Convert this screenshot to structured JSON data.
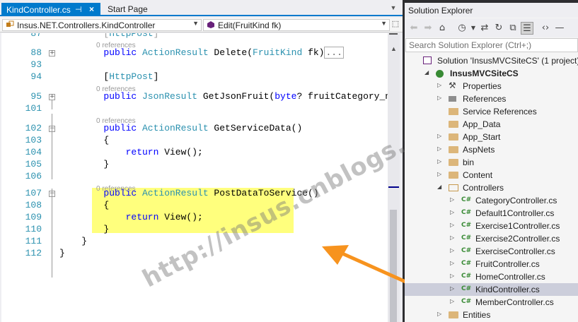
{
  "tabs": {
    "active_label": "KindController.cs",
    "pin_icon": "pin-icon",
    "close_glyph": "×",
    "start_label": "Start Page"
  },
  "navbar": {
    "class_value": "Insus.NET.Controllers.KindController",
    "member_value": "Edit(FruitKind fk)"
  },
  "code": {
    "lines": [
      {
        "num": "87",
        "text": "[HttpPost]"
      },
      {
        "ref": "0 references"
      },
      {
        "num": "88",
        "pre": "public ",
        "type": "ActionResult",
        "post": " Delete(",
        "type2": "FruitKind",
        "post2": " fk)",
        "collapsed": "..."
      },
      {
        "num": "93"
      },
      {
        "num": "94",
        "text": "[HttpPost]"
      },
      {
        "ref": "0 references"
      },
      {
        "num": "95",
        "pre": "public ",
        "type": "JsonResult",
        "post": " GetJsonFruit(",
        "kw2": "byte",
        "post2": "? fruitCategory_nbr)",
        "collapsed": "..."
      },
      {
        "num": "101"
      },
      {
        "ref": "0 references"
      },
      {
        "num": "102",
        "pre": "public ",
        "type": "ActionResult",
        "post": " GetServiceData()"
      },
      {
        "num": "103",
        "text": "{"
      },
      {
        "num": "104",
        "kwtext": "return",
        "text": " View();"
      },
      {
        "num": "105",
        "text": "}"
      },
      {
        "num": "106"
      },
      {
        "ref": "0 references"
      },
      {
        "num": "107",
        "pre": "public ",
        "type": "ActionResult",
        "post": " PostDataToService()"
      },
      {
        "num": "108",
        "text": "{"
      },
      {
        "num": "109",
        "kwtext": "return",
        "text": " View();"
      },
      {
        "num": "110",
        "text": "}"
      },
      {
        "num": "111",
        "text": "}"
      },
      {
        "num": "112",
        "text": "}"
      }
    ]
  },
  "watermark": "http://insus.cnblogs.com",
  "solution_explorer": {
    "title": "Solution Explorer",
    "search_placeholder": "Search Solution Explorer (Ctrl+;)",
    "toolbar_icons": [
      "back-icon",
      "forward-icon",
      "home-icon",
      "history-icon",
      "sync-icon",
      "refresh-icon",
      "collapse-all-icon",
      "show-all-files-icon",
      "view-code-icon",
      "properties-icon"
    ],
    "tree": [
      {
        "label": "Solution 'InsusMVCSiteCS' (1 project)",
        "icon": "solution-icon",
        "indent": 0,
        "exp": ""
      },
      {
        "label": "InsusMVCSiteCS",
        "icon": "web-project-icon",
        "indent": 1,
        "exp": "open",
        "bold": true
      },
      {
        "label": "Properties",
        "icon": "wrench-icon",
        "indent": 2,
        "exp": "closed"
      },
      {
        "label": "References",
        "icon": "references-icon",
        "indent": 2,
        "exp": "closed"
      },
      {
        "label": "Service References",
        "icon": "service-references-icon",
        "indent": 2,
        "exp": ""
      },
      {
        "label": "App_Data",
        "icon": "folder-icon",
        "indent": 2,
        "exp": ""
      },
      {
        "label": "App_Start",
        "icon": "folder-icon",
        "indent": 2,
        "exp": "closed"
      },
      {
        "label": "AspNets",
        "icon": "folder-icon",
        "indent": 2,
        "exp": "closed"
      },
      {
        "label": "bin",
        "icon": "folder-icon",
        "indent": 2,
        "exp": "closed"
      },
      {
        "label": "Content",
        "icon": "folder-icon",
        "indent": 2,
        "exp": "closed"
      },
      {
        "label": "Controllers",
        "icon": "folder-open-icon",
        "indent": 2,
        "exp": "open"
      },
      {
        "label": "CategoryController.cs",
        "icon": "csharp-file-icon",
        "indent": 3,
        "exp": "closed"
      },
      {
        "label": "Default1Controller.cs",
        "icon": "csharp-file-icon",
        "indent": 3,
        "exp": "closed"
      },
      {
        "label": "Exercise1Controller.cs",
        "icon": "csharp-file-icon",
        "indent": 3,
        "exp": "closed"
      },
      {
        "label": "Exercise2Controller.cs",
        "icon": "csharp-file-icon",
        "indent": 3,
        "exp": "closed"
      },
      {
        "label": "ExerciseController.cs",
        "icon": "csharp-file-icon",
        "indent": 3,
        "exp": "closed"
      },
      {
        "label": "FruitController.cs",
        "icon": "csharp-file-icon",
        "indent": 3,
        "exp": "closed"
      },
      {
        "label": "HomeController.cs",
        "icon": "csharp-file-icon",
        "indent": 3,
        "exp": "closed"
      },
      {
        "label": "KindController.cs",
        "icon": "csharp-file-icon",
        "indent": 3,
        "exp": "closed",
        "selected": true
      },
      {
        "label": "MemberController.cs",
        "icon": "csharp-file-icon",
        "indent": 3,
        "exp": "closed"
      },
      {
        "label": "Entities",
        "icon": "folder-icon",
        "indent": 2,
        "exp": "closed"
      }
    ],
    "csharp_glyph": "C#"
  },
  "colors": {
    "accent": "#007acc",
    "keyword": "#0000ff",
    "type": "#2b91af",
    "highlight": "#ffff66",
    "arrow": "#f7931e"
  }
}
